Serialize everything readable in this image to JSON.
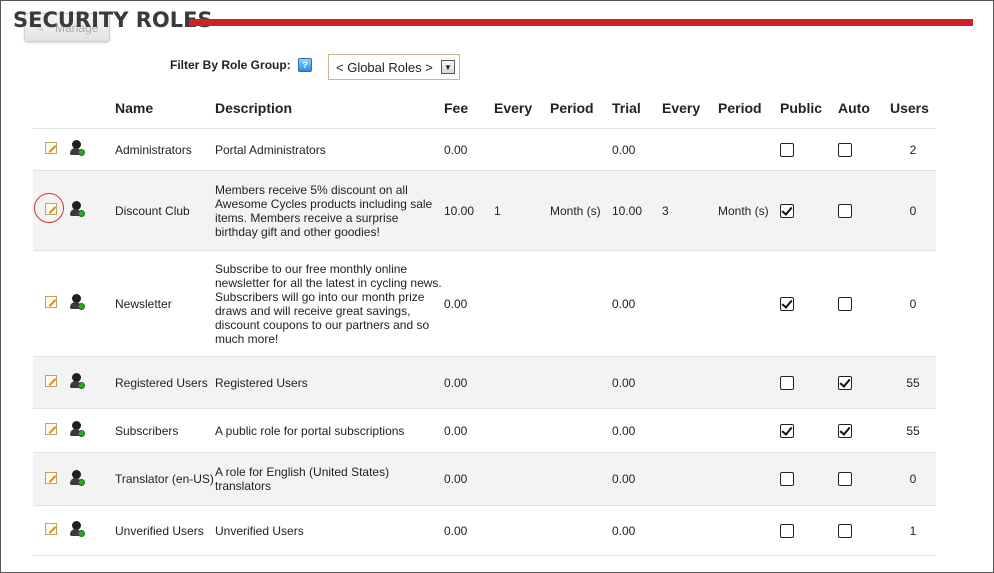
{
  "page": {
    "title": "SECURITY ROLES",
    "manage_label": "Manage",
    "filter_label": "Filter By Role Group:",
    "help_icon": "help-icon",
    "role_group_selected": "< Global Roles >"
  },
  "columns": {
    "name": "Name",
    "description": "Description",
    "fee": "Fee",
    "every": "Every",
    "period": "Period",
    "trial": "Trial",
    "every2": "Every",
    "period2": "Period",
    "public": "Public",
    "auto": "Auto",
    "users": "Users"
  },
  "colors": {
    "accent": "#d0202a"
  },
  "rows": [
    {
      "name": "Administrators",
      "description": "Portal Administrators",
      "fee": "0.00",
      "every": "",
      "period": "",
      "trial": "0.00",
      "every2": "",
      "period2": "",
      "public": false,
      "auto": false,
      "users": "2"
    },
    {
      "name": "Discount Club",
      "description": "Members receive 5% discount on all Awesome Cycles products including sale items. Members receive a surprise birthday gift and other goodies!",
      "fee": "10.00",
      "every": "1",
      "period": "Month (s)",
      "trial": "10.00",
      "every2": "3",
      "period2": "Month (s)",
      "public": true,
      "auto": false,
      "users": "0",
      "highlighted": true
    },
    {
      "name": "Newsletter",
      "description": "Subscribe to our free monthly online newsletter for all the latest in cycling news. Subscribers will go into our month prize draws and will receive great savings, discount coupons to our partners and so much more!",
      "fee": "0.00",
      "every": "",
      "period": "",
      "trial": "0.00",
      "every2": "",
      "period2": "",
      "public": true,
      "auto": false,
      "users": "0"
    },
    {
      "name": "Registered Users",
      "description": "Registered Users",
      "fee": "0.00",
      "every": "",
      "period": "",
      "trial": "0.00",
      "every2": "",
      "period2": "",
      "public": false,
      "auto": true,
      "users": "55"
    },
    {
      "name": "Subscribers",
      "description": "A public role for portal subscriptions",
      "fee": "0.00",
      "every": "",
      "period": "",
      "trial": "0.00",
      "every2": "",
      "period2": "",
      "public": true,
      "auto": true,
      "users": "55"
    },
    {
      "name": "Translator (en-US)",
      "description": "A role for English (United States) translators",
      "fee": "0.00",
      "every": "",
      "period": "",
      "trial": "0.00",
      "every2": "",
      "period2": "",
      "public": false,
      "auto": false,
      "users": "0"
    },
    {
      "name": "Unverified Users",
      "description": "Unverified Users",
      "fee": "0.00",
      "every": "",
      "period": "",
      "trial": "0.00",
      "every2": "",
      "period2": "",
      "public": false,
      "auto": false,
      "users": "1"
    }
  ]
}
